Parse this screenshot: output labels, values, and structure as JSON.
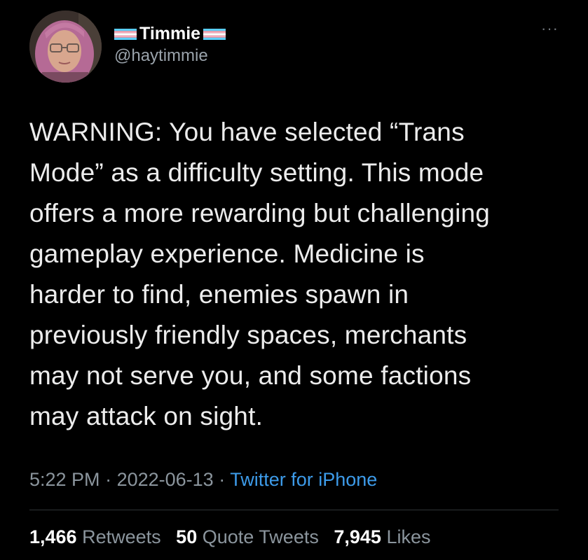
{
  "user": {
    "display_name": "Timmie",
    "handle": "@haytimmie",
    "flag_icon": "transgender-pride-flag-icon",
    "flag_colors": [
      "#5bcefa",
      "#f5a9b8",
      "#ffffff"
    ]
  },
  "more_icon": "ellipsis-icon",
  "more_label": "···",
  "tweet": {
    "lines": [
      "WARNING: You have selected “Trans",
      "Mode” as a difficulty setting. This mode",
      "offers a more rewarding but challenging",
      "gameplay experience. Medicine is",
      "harder to find, enemies spawn in",
      "previously friendly spaces, merchants",
      "may not serve you, and some factions",
      "may attack on sight."
    ]
  },
  "meta": {
    "time": "5:22 PM",
    "separator": " · ",
    "date": "2022-06-13",
    "source": "Twitter for iPhone"
  },
  "stats": {
    "retweets_count": "1,466",
    "retweets_label": "Retweets",
    "quotes_count": "50",
    "quotes_label": "Quote Tweets",
    "likes_count": "7,945",
    "likes_label": "Likes"
  },
  "colors": {
    "background": "#000000",
    "link": "#3d9be9",
    "muted": "#8b959d"
  }
}
